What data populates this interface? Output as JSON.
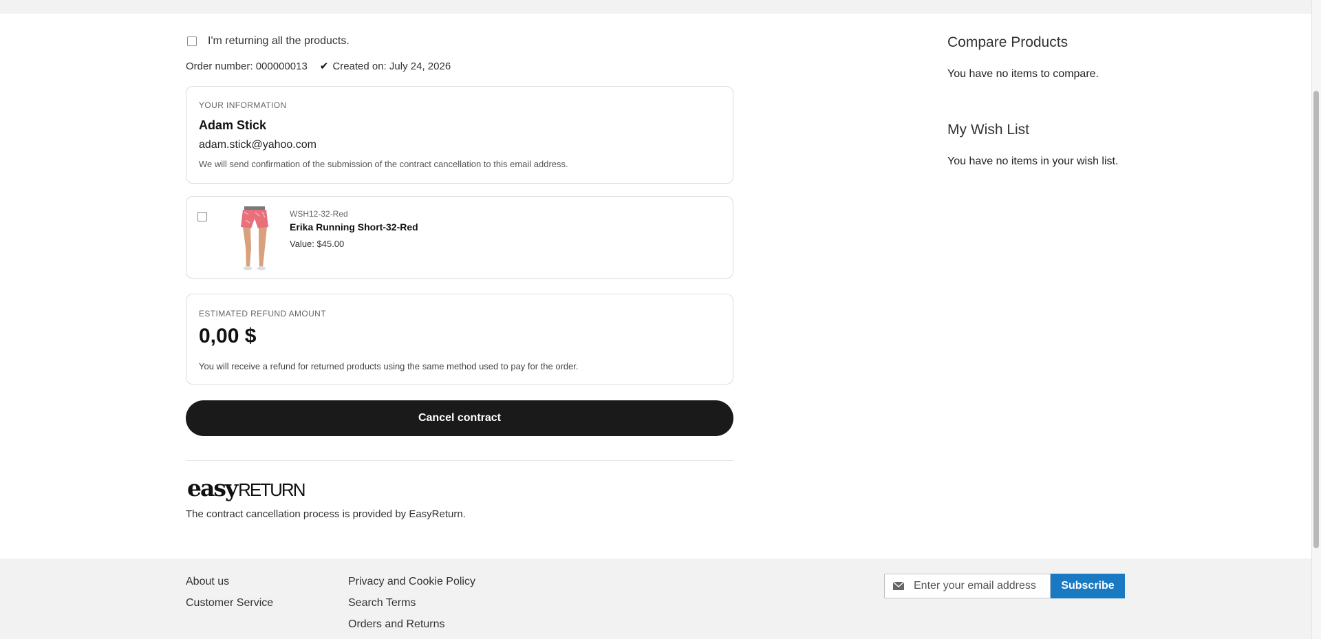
{
  "form": {
    "return_all_label": "I'm returning all the products.",
    "order_number_label": "Order number: 000000013",
    "created_on_label": "Created on: July 24, 2026"
  },
  "your_information": {
    "section_label": "YOUR INFORMATION",
    "name": "Adam Stick",
    "email": "adam.stick@yahoo.com",
    "note": "We will send confirmation of the submission of the contract cancellation to this email address."
  },
  "product": {
    "sku": "WSH12-32-Red",
    "name": "Erika Running Short-32-Red",
    "value_label": "Value: $45.00",
    "image_icon": "shorts-product-photo"
  },
  "refund": {
    "section_label": "ESTIMATED REFUND AMOUNT",
    "amount": "0,00 $",
    "note": "You will receive a refund for returned products using the same method used to pay for the order."
  },
  "actions": {
    "cancel_label": "Cancel contract"
  },
  "provider": {
    "logo_easy": "easy",
    "logo_return": "RETURN",
    "text": "The contract cancellation process is provided by EasyReturn."
  },
  "sidebar": {
    "compare_title": "Compare Products",
    "compare_text": "You have no items to compare.",
    "wishlist_title": "My Wish List",
    "wishlist_text": "You have no items in your wish list."
  },
  "footer": {
    "links_col1": [
      "About us",
      "Customer Service"
    ],
    "links_col2": [
      "Privacy and Cookie Policy",
      "Search Terms",
      "Orders and Returns"
    ],
    "newsletter_placeholder": "Enter your email address",
    "subscribe_label": "Subscribe"
  },
  "colors": {
    "primary_button": "#1a1a1a",
    "subscribe_button": "#1979c3",
    "footer_bg": "#f2f2f2"
  }
}
